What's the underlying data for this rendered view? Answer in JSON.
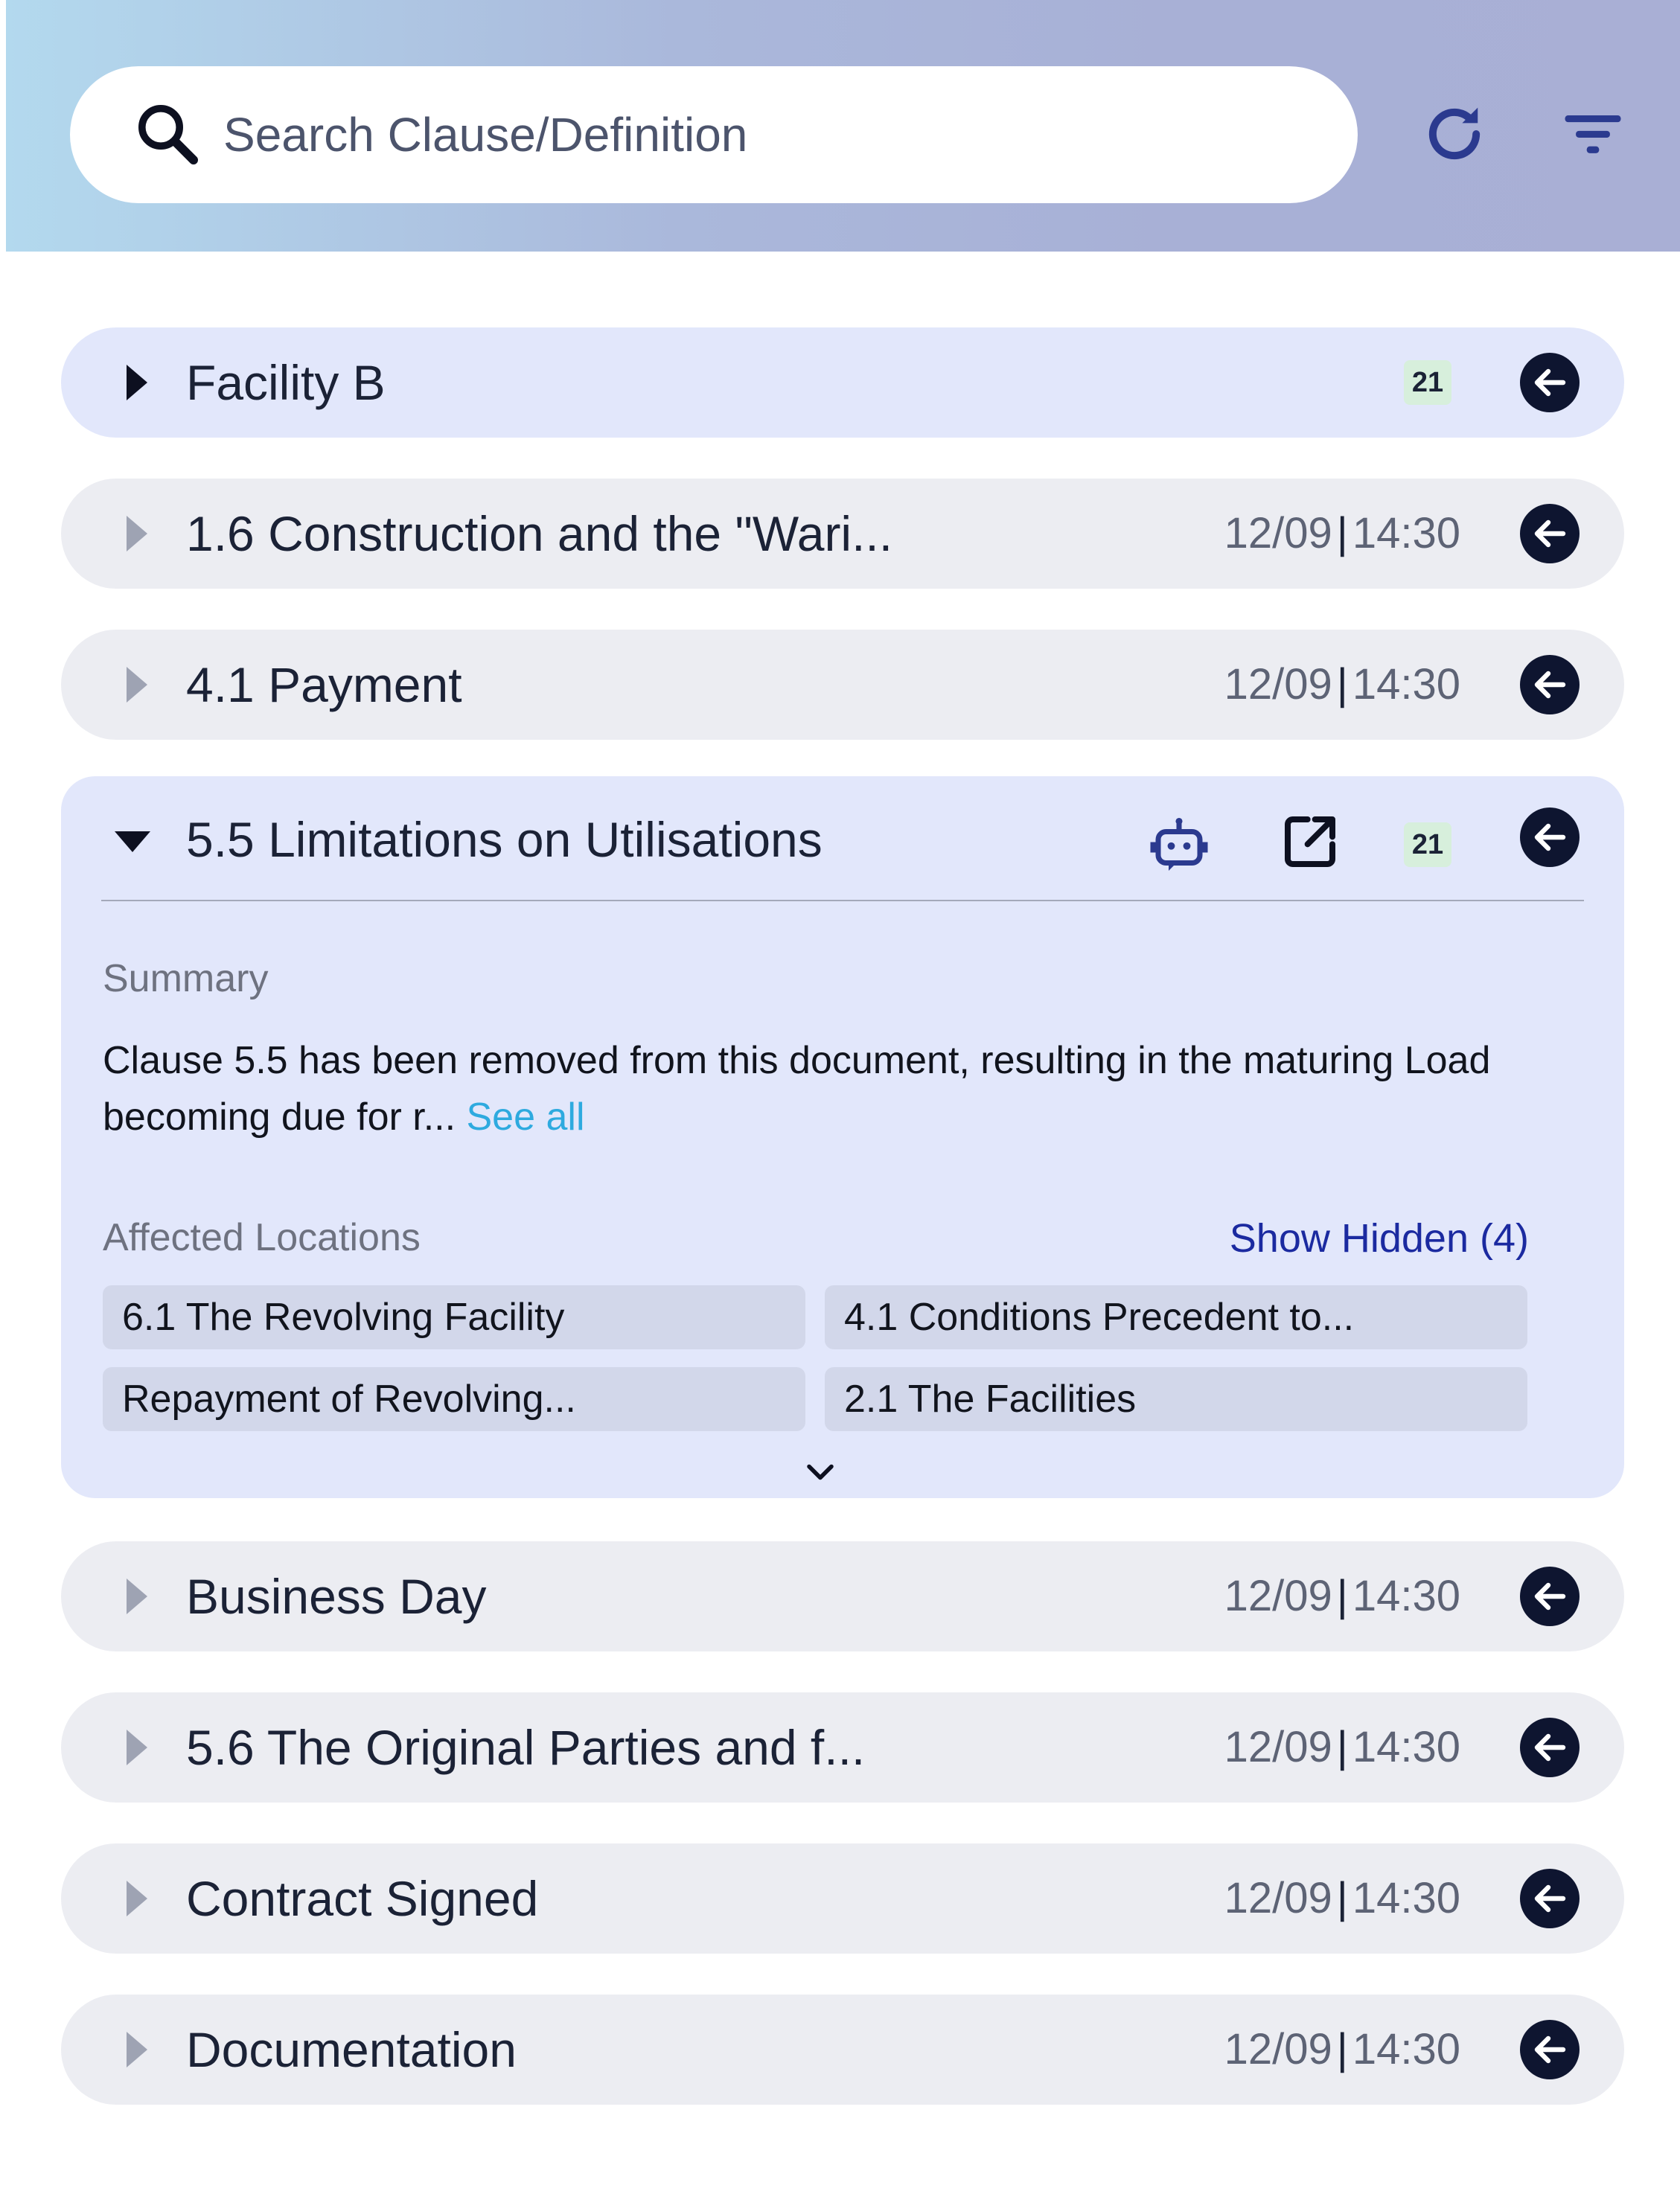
{
  "search": {
    "placeholder": "Search Clause/Definition",
    "value": ""
  },
  "header": {
    "refresh_icon": "refresh-icon",
    "filter_icon": "filter-icon",
    "search_icon": "search-icon"
  },
  "rows_top": [
    {
      "title": "Facility B",
      "badge": "21",
      "active": true
    },
    {
      "title": "1.6 Construction and the \"Wari...",
      "date": "12/09",
      "time": "14:30"
    },
    {
      "title": "4.1 Payment",
      "date": "12/09",
      "time": "14:30"
    }
  ],
  "expanded": {
    "title": "5.5 Limitations on Utilisations",
    "badge": "21",
    "summary_label": "Summary",
    "summary_text": "Clause 5.5 has been removed from this document, resulting in the maturing Load becoming due for r...",
    "see_all": "See all",
    "affected_label": "Affected Locations",
    "show_hidden": "Show Hidden (4)",
    "locations": [
      "6.1 The Revolving Facility",
      "4.1 Conditions Precedent to...",
      "Repayment of Revolving...",
      "2.1 The Facilities"
    ]
  },
  "rows_bottom": [
    {
      "title": "Business Day",
      "date": "12/09",
      "time": "14:30"
    },
    {
      "title": "5.6 The Original Parties and f...",
      "date": "12/09",
      "time": "14:30"
    },
    {
      "title": "Contract Signed",
      "date": "12/09",
      "time": "14:30"
    },
    {
      "title": "Documentation",
      "date": "12/09",
      "time": "14:30"
    }
  ],
  "colors": {
    "accent": "#2b3a8f",
    "link": "#2eaadf",
    "show_hidden": "#1b2aa0",
    "badge_bg": "#d7efdc"
  }
}
